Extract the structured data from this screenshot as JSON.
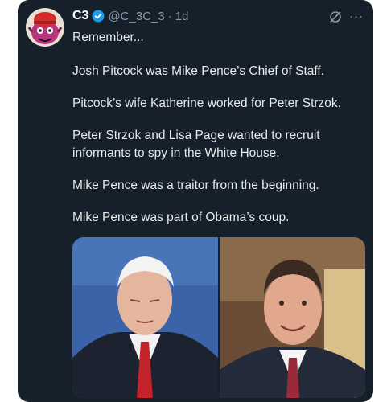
{
  "post": {
    "display_name": "C3",
    "handle": "@C_3C_3",
    "separator": "·",
    "time": "1d",
    "more_label": "···",
    "lines": [
      "Remember...",
      "Josh Pitcock was Mike Pence’s Chief of Staff.",
      "Pitcock’s wife Katherine worked for Peter Strzok.",
      "Peter Strzok and Lisa Page wanted to recruit informants to spy in the White House.",
      "Mike Pence was a traitor from the beginning.",
      "Mike Pence was part of Obama’s coup."
    ]
  },
  "icons": {
    "verified": "verified-badge-icon",
    "grok": "grok-icon",
    "more": "more-options-icon"
  },
  "colors": {
    "background": "#15202b",
    "text": "#e7e9ea",
    "muted": "#8b98a5",
    "verified_blue": "#1d9bf0"
  }
}
